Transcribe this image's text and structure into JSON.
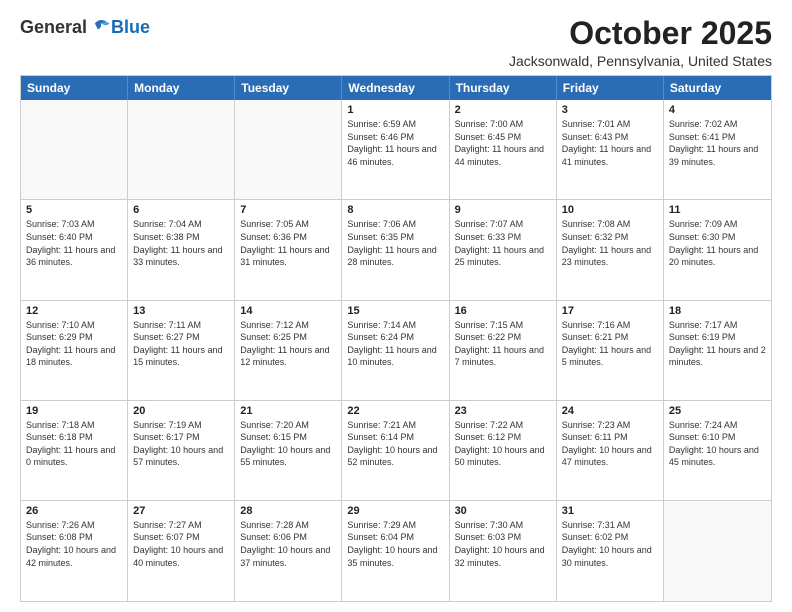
{
  "header": {
    "logo_general": "General",
    "logo_blue": "Blue",
    "month_title": "October 2025",
    "location": "Jacksonwald, Pennsylvania, United States"
  },
  "day_headers": [
    "Sunday",
    "Monday",
    "Tuesday",
    "Wednesday",
    "Thursday",
    "Friday",
    "Saturday"
  ],
  "weeks": [
    [
      {
        "date": "",
        "empty": true
      },
      {
        "date": "",
        "empty": true
      },
      {
        "date": "",
        "empty": true
      },
      {
        "date": "1",
        "sunrise": "Sunrise: 6:59 AM",
        "sunset": "Sunset: 6:46 PM",
        "daylight": "Daylight: 11 hours and 46 minutes."
      },
      {
        "date": "2",
        "sunrise": "Sunrise: 7:00 AM",
        "sunset": "Sunset: 6:45 PM",
        "daylight": "Daylight: 11 hours and 44 minutes."
      },
      {
        "date": "3",
        "sunrise": "Sunrise: 7:01 AM",
        "sunset": "Sunset: 6:43 PM",
        "daylight": "Daylight: 11 hours and 41 minutes."
      },
      {
        "date": "4",
        "sunrise": "Sunrise: 7:02 AM",
        "sunset": "Sunset: 6:41 PM",
        "daylight": "Daylight: 11 hours and 39 minutes."
      }
    ],
    [
      {
        "date": "5",
        "sunrise": "Sunrise: 7:03 AM",
        "sunset": "Sunset: 6:40 PM",
        "daylight": "Daylight: 11 hours and 36 minutes."
      },
      {
        "date": "6",
        "sunrise": "Sunrise: 7:04 AM",
        "sunset": "Sunset: 6:38 PM",
        "daylight": "Daylight: 11 hours and 33 minutes."
      },
      {
        "date": "7",
        "sunrise": "Sunrise: 7:05 AM",
        "sunset": "Sunset: 6:36 PM",
        "daylight": "Daylight: 11 hours and 31 minutes."
      },
      {
        "date": "8",
        "sunrise": "Sunrise: 7:06 AM",
        "sunset": "Sunset: 6:35 PM",
        "daylight": "Daylight: 11 hours and 28 minutes."
      },
      {
        "date": "9",
        "sunrise": "Sunrise: 7:07 AM",
        "sunset": "Sunset: 6:33 PM",
        "daylight": "Daylight: 11 hours and 25 minutes."
      },
      {
        "date": "10",
        "sunrise": "Sunrise: 7:08 AM",
        "sunset": "Sunset: 6:32 PM",
        "daylight": "Daylight: 11 hours and 23 minutes."
      },
      {
        "date": "11",
        "sunrise": "Sunrise: 7:09 AM",
        "sunset": "Sunset: 6:30 PM",
        "daylight": "Daylight: 11 hours and 20 minutes."
      }
    ],
    [
      {
        "date": "12",
        "sunrise": "Sunrise: 7:10 AM",
        "sunset": "Sunset: 6:29 PM",
        "daylight": "Daylight: 11 hours and 18 minutes."
      },
      {
        "date": "13",
        "sunrise": "Sunrise: 7:11 AM",
        "sunset": "Sunset: 6:27 PM",
        "daylight": "Daylight: 11 hours and 15 minutes."
      },
      {
        "date": "14",
        "sunrise": "Sunrise: 7:12 AM",
        "sunset": "Sunset: 6:25 PM",
        "daylight": "Daylight: 11 hours and 12 minutes."
      },
      {
        "date": "15",
        "sunrise": "Sunrise: 7:14 AM",
        "sunset": "Sunset: 6:24 PM",
        "daylight": "Daylight: 11 hours and 10 minutes."
      },
      {
        "date": "16",
        "sunrise": "Sunrise: 7:15 AM",
        "sunset": "Sunset: 6:22 PM",
        "daylight": "Daylight: 11 hours and 7 minutes."
      },
      {
        "date": "17",
        "sunrise": "Sunrise: 7:16 AM",
        "sunset": "Sunset: 6:21 PM",
        "daylight": "Daylight: 11 hours and 5 minutes."
      },
      {
        "date": "18",
        "sunrise": "Sunrise: 7:17 AM",
        "sunset": "Sunset: 6:19 PM",
        "daylight": "Daylight: 11 hours and 2 minutes."
      }
    ],
    [
      {
        "date": "19",
        "sunrise": "Sunrise: 7:18 AM",
        "sunset": "Sunset: 6:18 PM",
        "daylight": "Daylight: 11 hours and 0 minutes."
      },
      {
        "date": "20",
        "sunrise": "Sunrise: 7:19 AM",
        "sunset": "Sunset: 6:17 PM",
        "daylight": "Daylight: 10 hours and 57 minutes."
      },
      {
        "date": "21",
        "sunrise": "Sunrise: 7:20 AM",
        "sunset": "Sunset: 6:15 PM",
        "daylight": "Daylight: 10 hours and 55 minutes."
      },
      {
        "date": "22",
        "sunrise": "Sunrise: 7:21 AM",
        "sunset": "Sunset: 6:14 PM",
        "daylight": "Daylight: 10 hours and 52 minutes."
      },
      {
        "date": "23",
        "sunrise": "Sunrise: 7:22 AM",
        "sunset": "Sunset: 6:12 PM",
        "daylight": "Daylight: 10 hours and 50 minutes."
      },
      {
        "date": "24",
        "sunrise": "Sunrise: 7:23 AM",
        "sunset": "Sunset: 6:11 PM",
        "daylight": "Daylight: 10 hours and 47 minutes."
      },
      {
        "date": "25",
        "sunrise": "Sunrise: 7:24 AM",
        "sunset": "Sunset: 6:10 PM",
        "daylight": "Daylight: 10 hours and 45 minutes."
      }
    ],
    [
      {
        "date": "26",
        "sunrise": "Sunrise: 7:26 AM",
        "sunset": "Sunset: 6:08 PM",
        "daylight": "Daylight: 10 hours and 42 minutes."
      },
      {
        "date": "27",
        "sunrise": "Sunrise: 7:27 AM",
        "sunset": "Sunset: 6:07 PM",
        "daylight": "Daylight: 10 hours and 40 minutes."
      },
      {
        "date": "28",
        "sunrise": "Sunrise: 7:28 AM",
        "sunset": "Sunset: 6:06 PM",
        "daylight": "Daylight: 10 hours and 37 minutes."
      },
      {
        "date": "29",
        "sunrise": "Sunrise: 7:29 AM",
        "sunset": "Sunset: 6:04 PM",
        "daylight": "Daylight: 10 hours and 35 minutes."
      },
      {
        "date": "30",
        "sunrise": "Sunrise: 7:30 AM",
        "sunset": "Sunset: 6:03 PM",
        "daylight": "Daylight: 10 hours and 32 minutes."
      },
      {
        "date": "31",
        "sunrise": "Sunrise: 7:31 AM",
        "sunset": "Sunset: 6:02 PM",
        "daylight": "Daylight: 10 hours and 30 minutes."
      },
      {
        "date": "",
        "empty": true
      }
    ]
  ]
}
